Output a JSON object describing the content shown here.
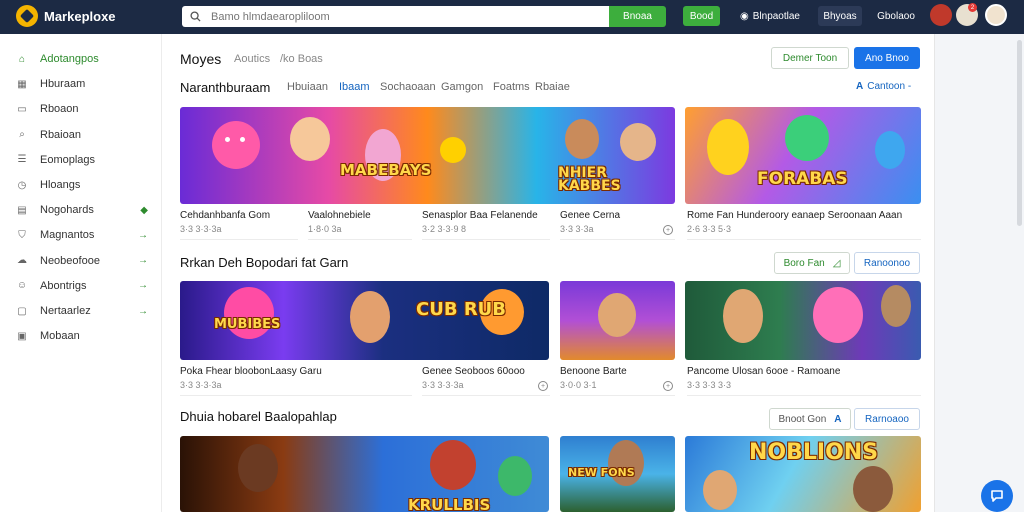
{
  "app": {
    "logo_text": "Markeploxe",
    "search_placeholder": "Bamo hlmdaearopliloom",
    "search_button": "Bnoaa",
    "green_button": "Bood",
    "top_link": "Blnpaotlae",
    "top_chip_1": "Bhyoas",
    "top_chip_2": "Gbolaoo",
    "notif_count": "2"
  },
  "sidebar": {
    "items": [
      {
        "label": "Adotangpos",
        "icon": "home-icon",
        "active": true
      },
      {
        "label": "Hburaam",
        "icon": "grid-icon"
      },
      {
        "label": "Rboaon",
        "icon": "file-icon"
      },
      {
        "label": "Rbaioan",
        "icon": "search-icon"
      },
      {
        "label": "Eomoplags",
        "icon": "list-icon"
      },
      {
        "label": "Hloangs",
        "icon": "clock-icon"
      },
      {
        "label": "Nogohards",
        "icon": "folder-icon",
        "arrow": "◆"
      },
      {
        "label": "Magnantos",
        "icon": "shield-icon",
        "arrow": "→"
      },
      {
        "label": "Neobeofooe",
        "icon": "cloud-icon",
        "arrow": "→"
      },
      {
        "label": "Abontrigs",
        "icon": "users-icon",
        "arrow": "→"
      },
      {
        "label": "Nertaarlez",
        "icon": "tag-icon",
        "arrow": "→"
      },
      {
        "label": "Mobaan",
        "icon": "box-icon"
      }
    ]
  },
  "header": {
    "title": "Moyes",
    "crumb_1": "Aoutics",
    "crumb_2": "/ko Boas",
    "btn_outline": "Demer Toon",
    "btn_primary": "Ano Bnoo"
  },
  "section1": {
    "title": "Naranthburaam",
    "tabs": [
      "Hbuiaan",
      "Ibaam",
      "Sochaoaan",
      "Gamgon",
      "Foatms",
      "Rbaiae"
    ],
    "active_tab": 1,
    "link": "Cantoon -"
  },
  "row1_cards": [
    {
      "title": "Cehdanhbanfa Gom",
      "meta": "3·3 3·3·3a"
    },
    {
      "title": "Vaalohnebiele",
      "meta": "1·8·0 3a"
    },
    {
      "title": "Senasplor Baa Felanende",
      "meta": "3·2 3·3·9 8"
    },
    {
      "title": "Genee Cerna",
      "meta": "3·3 3·3a"
    },
    {
      "title": "Rome Fan Hunderoory eanaep Seroonaan Aaan",
      "meta": "2·6 3·3 5·3"
    }
  ],
  "thumb_words": {
    "t1": "MABEBAYS",
    "t2": "NHIER KABBES",
    "t3": "FORABAS",
    "t4": "MUBIBES",
    "t5": "CUB RUB",
    "t6": "NOBLIONS",
    "t7": "KRULLBIS",
    "t8": "NEW FONS"
  },
  "section2": {
    "title": "Rrkan Deh Bopodari fat Garn",
    "btn_outline": "Boro Fan",
    "btn_secondary": "Ranoonoo"
  },
  "row2_cards": [
    {
      "title": "Poka Fhear bloobonLaasy Garu",
      "meta": "3·3 3·3·3a"
    },
    {
      "title": "Genee Seoboos 60ooo",
      "meta": "3·3 3·3·3a"
    },
    {
      "title": "Benoone Barte",
      "meta": "3·0·0 3·1"
    },
    {
      "title": "Pancome Ulosan 6ooe - Ramoane",
      "meta": "3·3 3·3 3·3"
    }
  ],
  "section3": {
    "title": "Dhuia hobarel Baalopahlap",
    "btn_outline": "Bnoot Gon",
    "btn_secondary": "Rarnoaoo"
  }
}
